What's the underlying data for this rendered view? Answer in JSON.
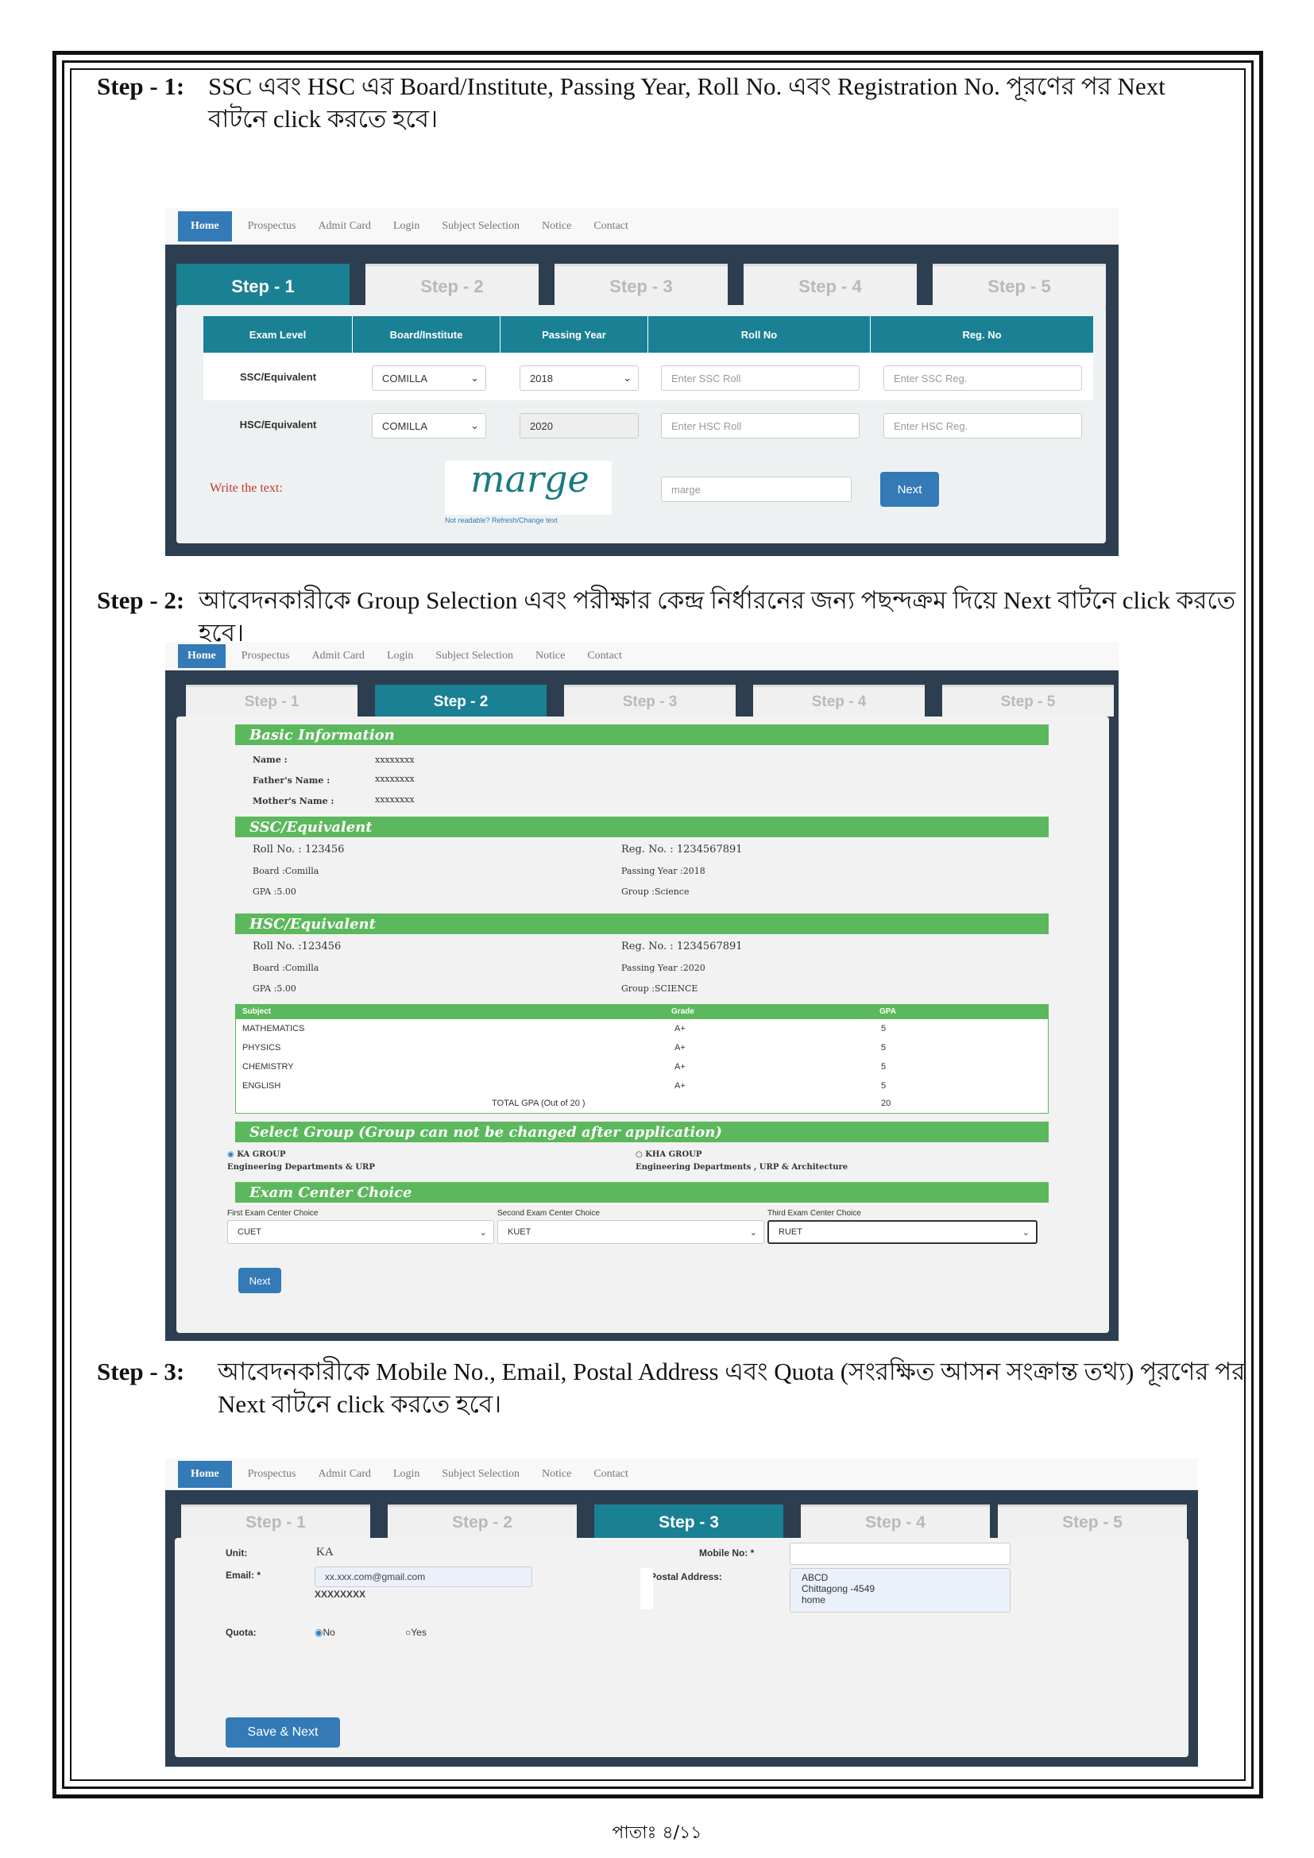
{
  "step1": {
    "head": "Step - 1:",
    "line1": "SSC এবং HSC এর Board/Institute, Passing Year, Roll No. এবং Registration No. পূরণের পর Next",
    "line2": "বাটনে click করতে হবে।"
  },
  "step2": {
    "head": "Step - 2:",
    "text": "আবেদনকারীকে Group Selection এবং পরীক্ষার কেন্দ্র নির্ধারনের জন্য পছন্দক্রম দিয়ে Next বাটনে click করতে হবে।"
  },
  "step3": {
    "head": "Step - 3:",
    "line1": "আবেদনকারীকে Mobile No., Email, Postal Address এবং Quota (সংরক্ষিত আসন সংক্রান্ত তথ্য) পূরণের পর",
    "line2": "Next বাটনে click করতে হবে।"
  },
  "nav": [
    "Home",
    "Prospectus",
    "Admit Card",
    "Login",
    "Subject Selection",
    "Notice",
    "Contact"
  ],
  "tabs": [
    "Step - 1",
    "Step - 2",
    "Step - 3",
    "Step - 4",
    "Step - 5"
  ],
  "shot1": {
    "headers": [
      "Exam Level",
      "Board/Institute",
      "Passing Year",
      "Roll No",
      "Reg. No"
    ],
    "rows": [
      {
        "level": "SSC/Equivalent",
        "board": "COMILLA",
        "year": "2018",
        "roll": "Enter SSC Roll",
        "reg": "Enter SSC Reg."
      },
      {
        "level": "HSC/Equivalent",
        "board": "COMILLA",
        "year": "2020",
        "roll": "Enter HSC Roll",
        "reg": "Enter HSC Reg."
      }
    ],
    "captcha_label": "Write the text:",
    "captcha_word": "marge",
    "captcha_refresh": "Not readable? Refresh/Change text",
    "captcha_input": "marge",
    "next": "Next"
  },
  "shot2": {
    "basic": "Basic Information",
    "name_l": "Name :",
    "name_v": "xxxxxxxx",
    "father_l": "Father's Name :",
    "father_v": "xxxxxxxx",
    "mother_l": "Mother's Name :",
    "mother_v": "xxxxxxxx",
    "ssc": "SSC/Equivalent",
    "ssc_roll": "Roll No. : 123456",
    "ssc_reg": "Reg. No. :  1234567891",
    "ssc_board": "Board :Comilla",
    "ssc_year": "Passing Year :2018",
    "ssc_gpa": "GPA :5.00",
    "ssc_group": "Group :Science",
    "hsc": "HSC/Equivalent",
    "hsc_roll": "Roll No. :123456",
    "hsc_reg": "Reg. No. : 1234567891",
    "hsc_board": "Board :Comilla",
    "hsc_year": "Passing Year :2020",
    "hsc_gpa": "GPA :5.00",
    "hsc_group": "Group :SCIENCE",
    "gt_head": [
      "Subject",
      "Grade",
      "GPA"
    ],
    "gt_rows": [
      [
        "MATHEMATICS",
        "A+",
        "5"
      ],
      [
        "PHYSICS",
        "A+",
        "5"
      ],
      [
        "CHEMISTRY",
        "A+",
        "5"
      ],
      [
        "ENGLISH",
        "A+",
        "5"
      ]
    ],
    "gt_total_l": "TOTAL GPA (Out of 20 )",
    "gt_total_v": "20",
    "group_head": "Select Group (Group can not be changed after application)",
    "ka": "KA GROUP",
    "ka_desc": "Engineering Departments & URP",
    "kha": "KHA GROUP",
    "kha_desc": "Engineering Departments , URP & Architecture",
    "center_head": "Exam Center Choice",
    "c1_l": "First Exam Center Choice",
    "c1": "CUET",
    "c2_l": "Second Exam Center Choice",
    "c2": "KUET",
    "c3_l": "Third Exam Center Choice",
    "c3": "RUET",
    "next": "Next"
  },
  "shot3": {
    "unit_l": "Unit:",
    "unit_v": "KA",
    "email_l": "Email: *",
    "email_v": "xx.xxx.com@gmail.com",
    "email_mask": "XXXXXXXX",
    "mobile_l": "Mobile No: *",
    "postal_l": "Postal  Address:",
    "postal_v": [
      "ABCD",
      "Chittagong -4549",
      "home"
    ],
    "quota_l": "Quota:",
    "no": "No",
    "yes": "Yes",
    "save": "Save & Next"
  },
  "footer": "পাতাঃ ৪/১১"
}
